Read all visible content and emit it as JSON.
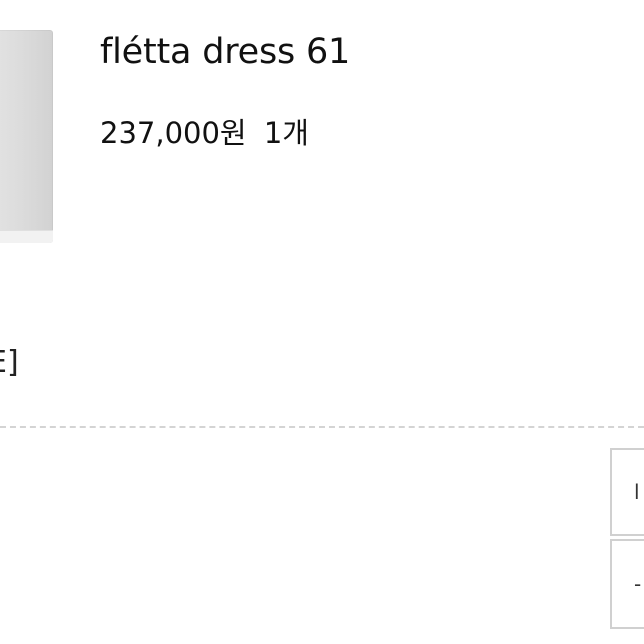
{
  "product": {
    "name": "flétta dress 61",
    "price": "237,000원",
    "quantity": "1개"
  },
  "option": {
    "text": "E]"
  },
  "buttons": {
    "top_label": "l",
    "bottom_label": "-"
  }
}
